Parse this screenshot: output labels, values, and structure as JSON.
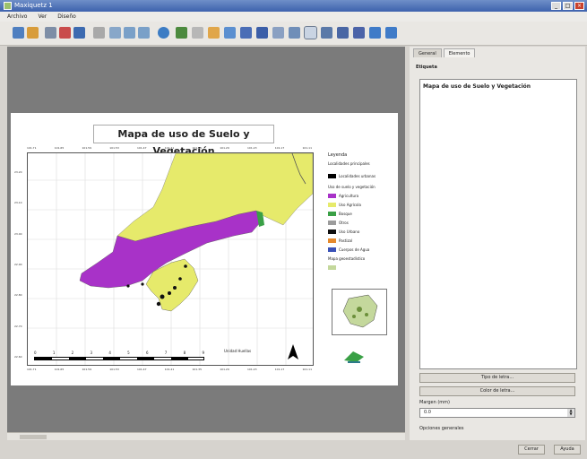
{
  "window": {
    "title": "Maxiquetz 1"
  },
  "menu": [
    "Archivo",
    "Ver",
    "Diseño"
  ],
  "map": {
    "title": "Mapa de uso de Suelo y Vegetación",
    "top_ticks": [
      "101.71",
      "101.65",
      "101.59",
      "101.53",
      "101.47",
      "101.41",
      "101.35",
      "101.29",
      "101.23",
      "101.17",
      "101.11"
    ],
    "bottom_ticks": [
      "101.71",
      "101.65",
      "101.59",
      "101.53",
      "101.47",
      "101.41",
      "101.35",
      "101.29",
      "101.23",
      "101.17",
      "101.11"
    ],
    "left_ticks": [
      "23.20",
      "23.10",
      "23.00",
      "22.90",
      "22.80",
      "22.70",
      "22.60"
    ],
    "scale_numbers": [
      "0",
      "1",
      "2",
      "3",
      "4",
      "5",
      "6",
      "7",
      "8",
      "9"
    ],
    "scale_unit": "Unidad Huellas",
    "colors": {
      "secano": "#e6ea6b",
      "pastizal": "#a832c8",
      "bosque": "#3aa046",
      "urbano": "#101010",
      "agua": "#3a52b8"
    }
  },
  "legend": {
    "title": "Leyenda",
    "subtitle": "Localidades principales",
    "items": [
      {
        "label": "Localidades urbanas",
        "color": "#000000"
      },
      {
        "label": "Uso de suelo y vegetación",
        "color": ""
      },
      {
        "label": "Agricultura",
        "color": "#a832c8"
      },
      {
        "label": "Uso Agrícola",
        "color": "#e6ea6b"
      },
      {
        "label": "Bosque",
        "color": "#3aa046"
      },
      {
        "label": "Otros",
        "color": "#9c9c9c"
      },
      {
        "label": "Uso Urbano",
        "color": "#101010"
      },
      {
        "label": "Pastizal",
        "color": "#e58a2e"
      },
      {
        "label": "Cuerpos de Agua",
        "color": "#3a52b8"
      },
      {
        "label": "Mapa geoestadístico",
        "color": "#c4d89c"
      }
    ]
  },
  "sidebar": {
    "tabs": [
      "General",
      "Elemento"
    ],
    "section_label": "Etiqueta",
    "label_text": "Mapa de uso de Suelo y Vegetación",
    "font_button": "Tipo de letra...",
    "color_button": "Color de letra...",
    "margin_label": "Margen (mm)",
    "margin_value": "0.0",
    "position_label": "Opciones generales"
  },
  "footer": {
    "close_button": "Cerrar",
    "help_button": "Ayuda"
  }
}
